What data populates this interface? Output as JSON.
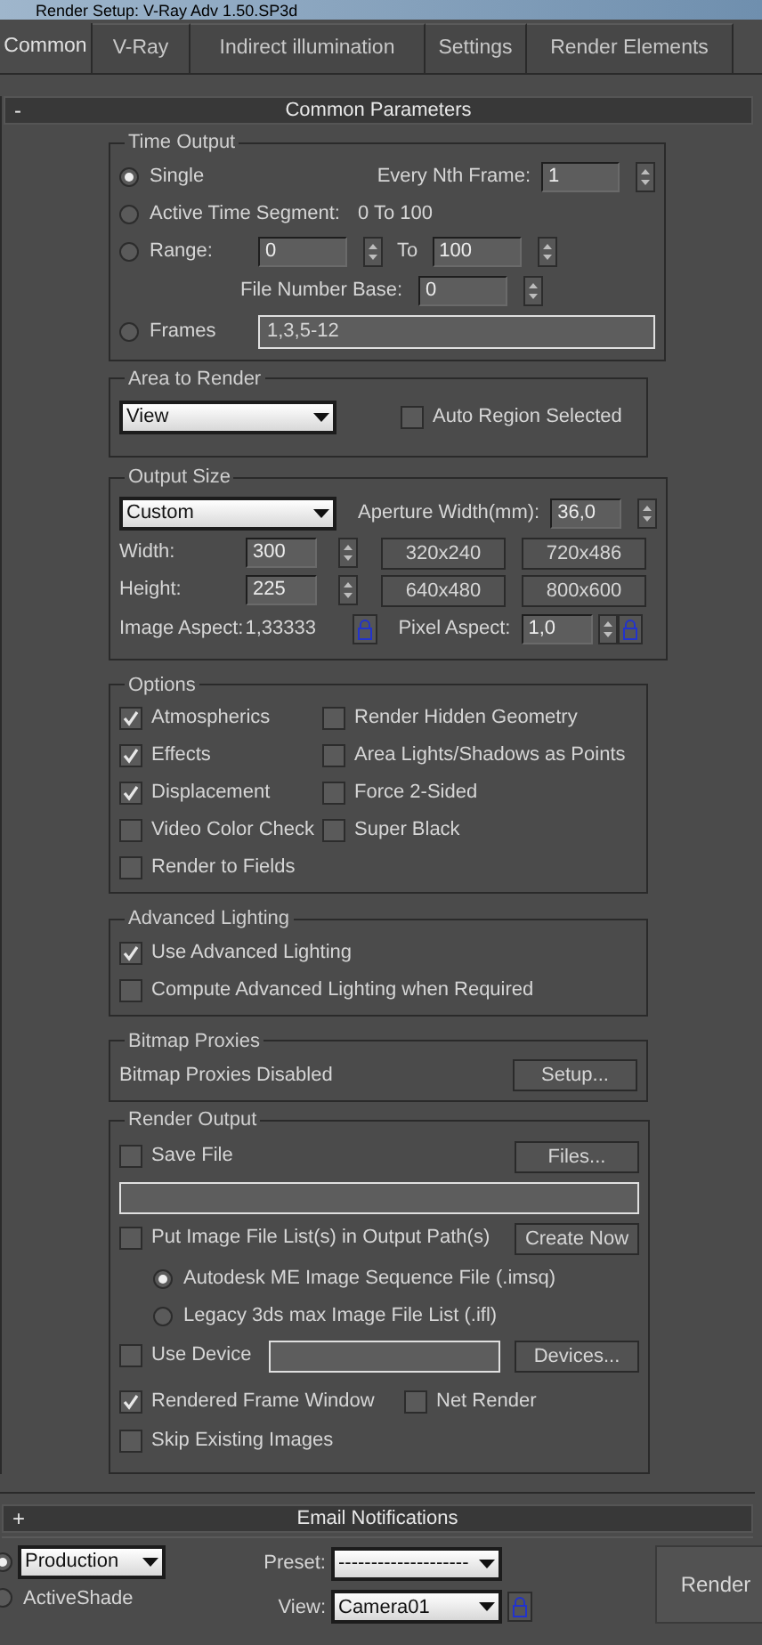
{
  "window": {
    "title": "Render Setup: V-Ray Adv 1.50.SP3d"
  },
  "tabs": [
    {
      "label": "Common",
      "selected": true
    },
    {
      "label": "V-Ray",
      "selected": false
    },
    {
      "label": "Indirect illumination",
      "selected": false
    },
    {
      "label": "Settings",
      "selected": false
    },
    {
      "label": "Render Elements",
      "selected": false
    }
  ],
  "common_parameters": {
    "toggle": "-",
    "title": "Common Parameters",
    "time_output": {
      "title": "Time Output",
      "modes": [
        {
          "label": "Single",
          "selected": true
        },
        {
          "label": "Active Time Segment:",
          "selected": false,
          "segment": "0 To 100"
        },
        {
          "label": "Range:",
          "selected": false
        },
        {
          "label": "Frames",
          "selected": false
        }
      ],
      "every_nth_frame": {
        "label": "Every Nth Frame:",
        "value": "1"
      },
      "range_start": "0",
      "range_to": "To",
      "range_end": "100",
      "file_number_base": {
        "label": "File Number Base:",
        "value": "0"
      },
      "frames": "1,3,5-12"
    },
    "area_to_render": {
      "title": "Area to Render",
      "dropdown": "View",
      "auto_region": {
        "label": "Auto Region Selected",
        "checked": false
      }
    },
    "output_size": {
      "title": "Output Size",
      "dropdown": "Custom",
      "aperture": {
        "label": "Aperture Width(mm):",
        "value": "36,0"
      },
      "width": {
        "label": "Width:",
        "value": "300"
      },
      "height": {
        "label": "Height:",
        "value": "225"
      },
      "presets": [
        "320x240",
        "720x486",
        "640x480",
        "800x600"
      ],
      "image_aspect": {
        "label": "Image Aspect:",
        "value": "1,33333"
      },
      "pixel_aspect": {
        "label": "Pixel Aspect:",
        "value": "1,0"
      }
    },
    "options": {
      "title": "Options",
      "left": [
        {
          "label": "Atmospherics",
          "checked": true
        },
        {
          "label": "Effects",
          "checked": true
        },
        {
          "label": "Displacement",
          "checked": true
        },
        {
          "label": "Video Color Check",
          "checked": false
        },
        {
          "label": "Render to Fields",
          "checked": false
        }
      ],
      "right": [
        {
          "label": "Render Hidden Geometry",
          "checked": false
        },
        {
          "label": "Area Lights/Shadows as Points",
          "checked": false
        },
        {
          "label": "Force 2-Sided",
          "checked": false
        },
        {
          "label": "Super Black",
          "checked": false
        }
      ]
    },
    "advanced_lighting": {
      "title": "Advanced Lighting",
      "items": [
        {
          "label": "Use Advanced Lighting",
          "checked": true
        },
        {
          "label": "Compute Advanced Lighting when Required",
          "checked": false
        }
      ]
    },
    "bitmap_proxies": {
      "title": "Bitmap Proxies",
      "status": "Bitmap Proxies Disabled",
      "button": "Setup..."
    },
    "render_output": {
      "title": "Render Output",
      "save_file": {
        "label": "Save File",
        "checked": false
      },
      "files_button": "Files...",
      "put_image_list": {
        "label": "Put Image File List(s) in Output Path(s)",
        "checked": false
      },
      "create_now_button": "Create Now",
      "list_formats": [
        {
          "label": "Autodesk ME Image Sequence File (.imsq)",
          "selected": true
        },
        {
          "label": "Legacy 3ds max Image File List (.ifl)",
          "selected": false
        }
      ],
      "use_device": {
        "label": "Use Device",
        "checked": false
      },
      "devices_button": "Devices...",
      "rendered_frame_window": {
        "label": "Rendered Frame Window",
        "checked": true
      },
      "net_render": {
        "label": "Net Render",
        "checked": false
      },
      "skip_existing": {
        "label": "Skip Existing Images",
        "checked": false
      }
    }
  },
  "email_notifications": {
    "toggle": "+",
    "title": "Email Notifications"
  },
  "footer": {
    "production": {
      "selected": true,
      "dropdown": "Production"
    },
    "activeshade": {
      "label": "ActiveShade",
      "selected": false
    },
    "preset": {
      "label": "Preset:",
      "value": "--------------------"
    },
    "view": {
      "label": "View:",
      "value": "Camera01"
    },
    "render_button": "Render"
  }
}
